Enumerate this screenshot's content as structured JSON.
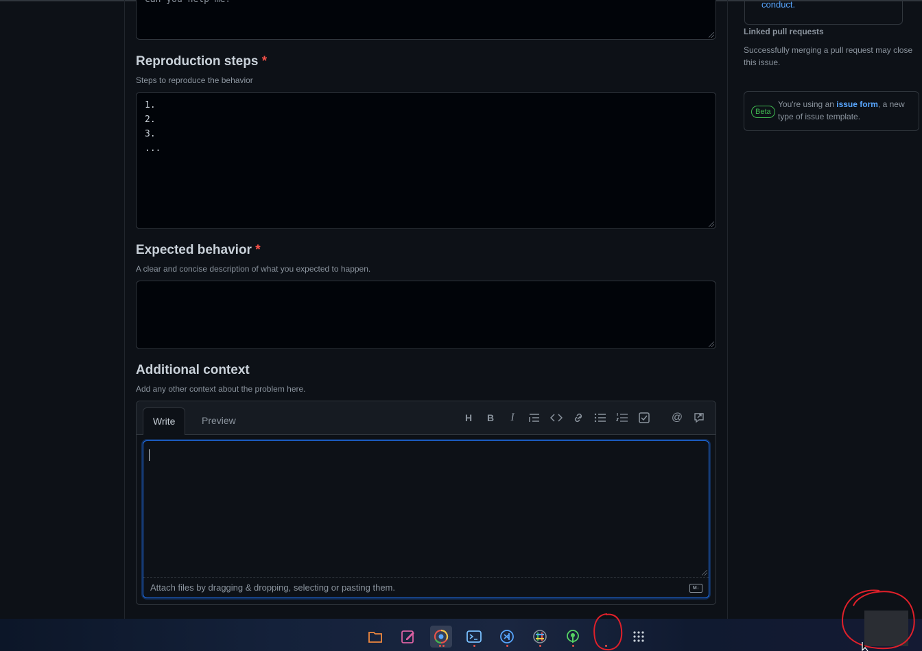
{
  "form": {
    "previous_answer_text": "Can you help me?",
    "reproduction": {
      "label": "Reproduction steps",
      "required_mark": "*",
      "description": "Steps to reproduce the behavior",
      "value": "1.\n2.\n3.\n..."
    },
    "expected": {
      "label": "Expected behavior",
      "required_mark": "*",
      "description": "A clear and concise description of what you expected to happen.",
      "value": ""
    },
    "additional": {
      "label": "Additional context",
      "description": "Add any other context about the problem here.",
      "tabs": [
        "Write",
        "Preview"
      ],
      "attach_text": "Attach files by dragging & dropping, selecting or pasting them.",
      "markdown_icon_text": "M↓",
      "toolbar_icons": [
        "heading-icon",
        "bold-icon",
        "italic-icon",
        "quote-icon",
        "code-icon",
        "link-icon",
        "unordered-list-icon",
        "ordered-list-icon",
        "task-list-icon",
        "mention-icon",
        "reference-icon"
      ]
    }
  },
  "sidebar": {
    "code_of_conduct_link": "conduct.",
    "linked_pr_title": "Linked pull requests",
    "linked_pr_desc": "Successfully merging a pull request may close this issue.",
    "beta_badge": "Beta",
    "beta_text_prefix": "You're using an ",
    "beta_text_link": "issue form",
    "beta_text_suffix": ", a new type of issue template."
  },
  "taskbar": {
    "apps": [
      "files-icon",
      "text-editor-icon",
      "chrome-icon",
      "terminal-icon",
      "vscode-icon",
      "slack-icon",
      "podcast-icon",
      "app-grid-icon"
    ]
  },
  "colors": {
    "accent": "#58a6ff",
    "required": "#f85149",
    "focus": "#1f6feb",
    "annotation": "#e0202a"
  }
}
